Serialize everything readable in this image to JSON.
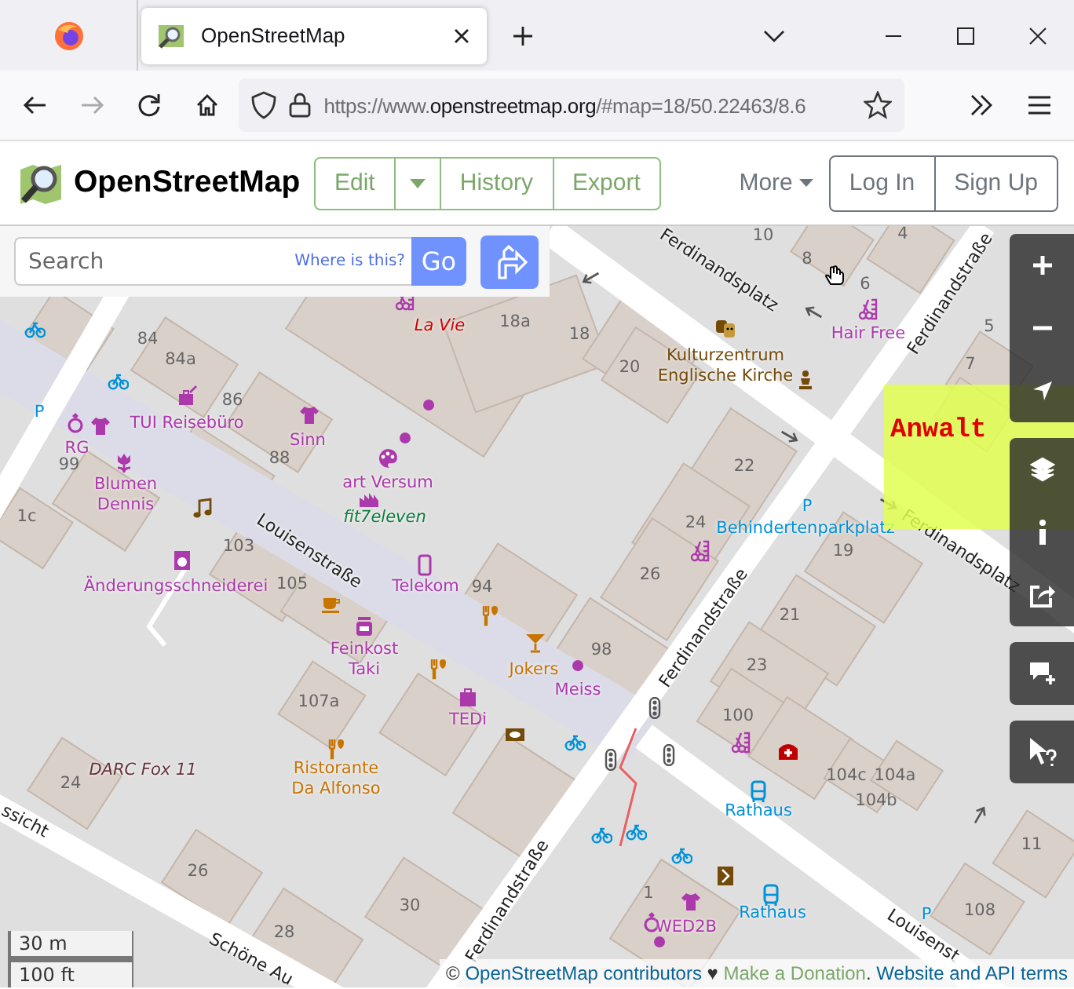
{
  "browser": {
    "tab": {
      "title": "OpenStreetMap",
      "selected": true
    },
    "url": {
      "scheme": "https://www.",
      "domain": "openstreetmap.org",
      "rest": "/#map=18/50.22463/8.6"
    }
  },
  "header": {
    "logo": "OpenStreetMap",
    "nav": [
      "Edit",
      "History",
      "Export"
    ],
    "more": "More",
    "auth": [
      "Log In",
      "Sign Up"
    ]
  },
  "search": {
    "placeholder": "Search",
    "locate_link": "Where is this?",
    "button": "Go"
  },
  "map": {
    "streets": [
      {
        "text": "Ferdinandsplatz"
      },
      {
        "text": "Ferdinandsplatz"
      },
      {
        "text": "Ferdinandstraße"
      },
      {
        "text": "Louisenstraße"
      },
      {
        "text": "Ferdinandstraße"
      },
      {
        "text": "Ferdinandstraße"
      },
      {
        "text": "Louisenst"
      },
      {
        "text": "Schöne Au"
      },
      {
        "text": "ssicht"
      }
    ],
    "house_numbers": [
      "10",
      "8",
      "4",
      "6",
      "84",
      "84a",
      "86",
      "88",
      "99",
      "1c",
      "103",
      "105",
      "18a",
      "18",
      "20",
      "5",
      "7",
      "22",
      "24",
      "26",
      "19",
      "21",
      "94",
      "98",
      "107a",
      "24",
      "26",
      "28",
      "30",
      "23",
      "100",
      "104c",
      "104a",
      "104b",
      "11",
      "108",
      "1"
    ],
    "places": [
      {
        "text": "La Vie",
        "kind": "club"
      },
      {
        "text": "TUI Reisebüro",
        "kind": "shop"
      },
      {
        "text": "Sinn",
        "kind": "shop"
      },
      {
        "text": "RG",
        "kind": "shop"
      },
      {
        "text": "Blumen Dennis",
        "kind": "shop"
      },
      {
        "text": "art Versum",
        "kind": "shop"
      },
      {
        "text": "fit7eleven",
        "kind": "sport"
      },
      {
        "text": "Änderungsschneiderei",
        "kind": "shop"
      },
      {
        "text": "Telekom",
        "kind": "shop"
      },
      {
        "text": "Feinkost Taki",
        "kind": "shop"
      },
      {
        "text": "Jokers",
        "kind": "food"
      },
      {
        "text": "Meiss",
        "kind": "shop"
      },
      {
        "text": "TEDi",
        "kind": "shop"
      },
      {
        "text": "DARC Fox 11",
        "kind": "amenity"
      },
      {
        "text": "Ristorante Da Alfonso",
        "kind": "food"
      },
      {
        "text": "Kulturzentrum Englische Kirche",
        "kind": "culture"
      },
      {
        "text": "Hair Free",
        "kind": "shop"
      },
      {
        "text": "P",
        "kind": "transport"
      },
      {
        "text": "Behindertenparkplatz",
        "kind": "transport"
      },
      {
        "text": "Rathaus",
        "kind": "transport"
      },
      {
        "text": "Rathaus",
        "kind": "transport"
      },
      {
        "text": "WED2B",
        "kind": "shop"
      },
      {
        "text": "P",
        "kind": "transport"
      },
      {
        "text": "P",
        "kind": "transport"
      }
    ],
    "overlay": {
      "text": "Anwalt"
    }
  },
  "scale": [
    "30 m",
    "100 ft"
  ],
  "attribution": [
    {
      "kind": "text",
      "text": "© "
    },
    {
      "kind": "link",
      "text": "OpenStreetMap contributors"
    },
    {
      "kind": "text",
      "text": " ♥ "
    },
    {
      "kind": "donate",
      "text": "Make a Donation"
    },
    {
      "kind": "text",
      "text": ". "
    },
    {
      "kind": "link",
      "text": "Website and API terms"
    }
  ]
}
